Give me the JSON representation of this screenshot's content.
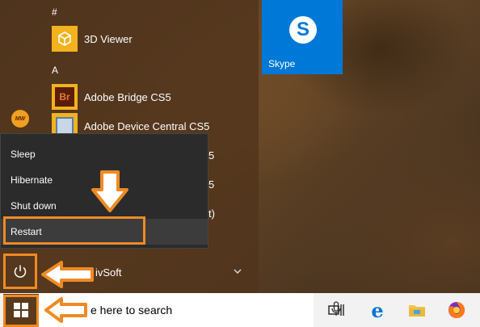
{
  "start_menu": {
    "groups": [
      {
        "letter": "#",
        "apps": [
          {
            "label": "3D Viewer",
            "icon": "3d-viewer-icon"
          }
        ]
      },
      {
        "letter": "A",
        "apps": [
          {
            "label": "Adobe Bridge CS5",
            "icon": "adobe-bridge-icon"
          },
          {
            "label": "Adobe Device Central CS5",
            "icon": "adobe-device-central-icon"
          }
        ]
      }
    ],
    "clipped_labels": [
      "5",
      "5",
      "t)",
      "ivSoft"
    ],
    "avatar_text": "MW"
  },
  "tiles": [
    {
      "label": "Skype",
      "icon": "skype-icon",
      "color": "#0078d7"
    }
  ],
  "power_menu": {
    "items": [
      {
        "label": "Sleep"
      },
      {
        "label": "Hibernate"
      },
      {
        "label": "Shut down"
      },
      {
        "label": "Restart"
      }
    ],
    "highlighted": "Restart"
  },
  "taskbar": {
    "search_placeholder": "e here to search",
    "icons": [
      "task-view-icon",
      "edge-icon",
      "file-explorer-icon",
      "firefox-icon"
    ]
  },
  "annotations": {
    "accent": "#f08a24"
  }
}
